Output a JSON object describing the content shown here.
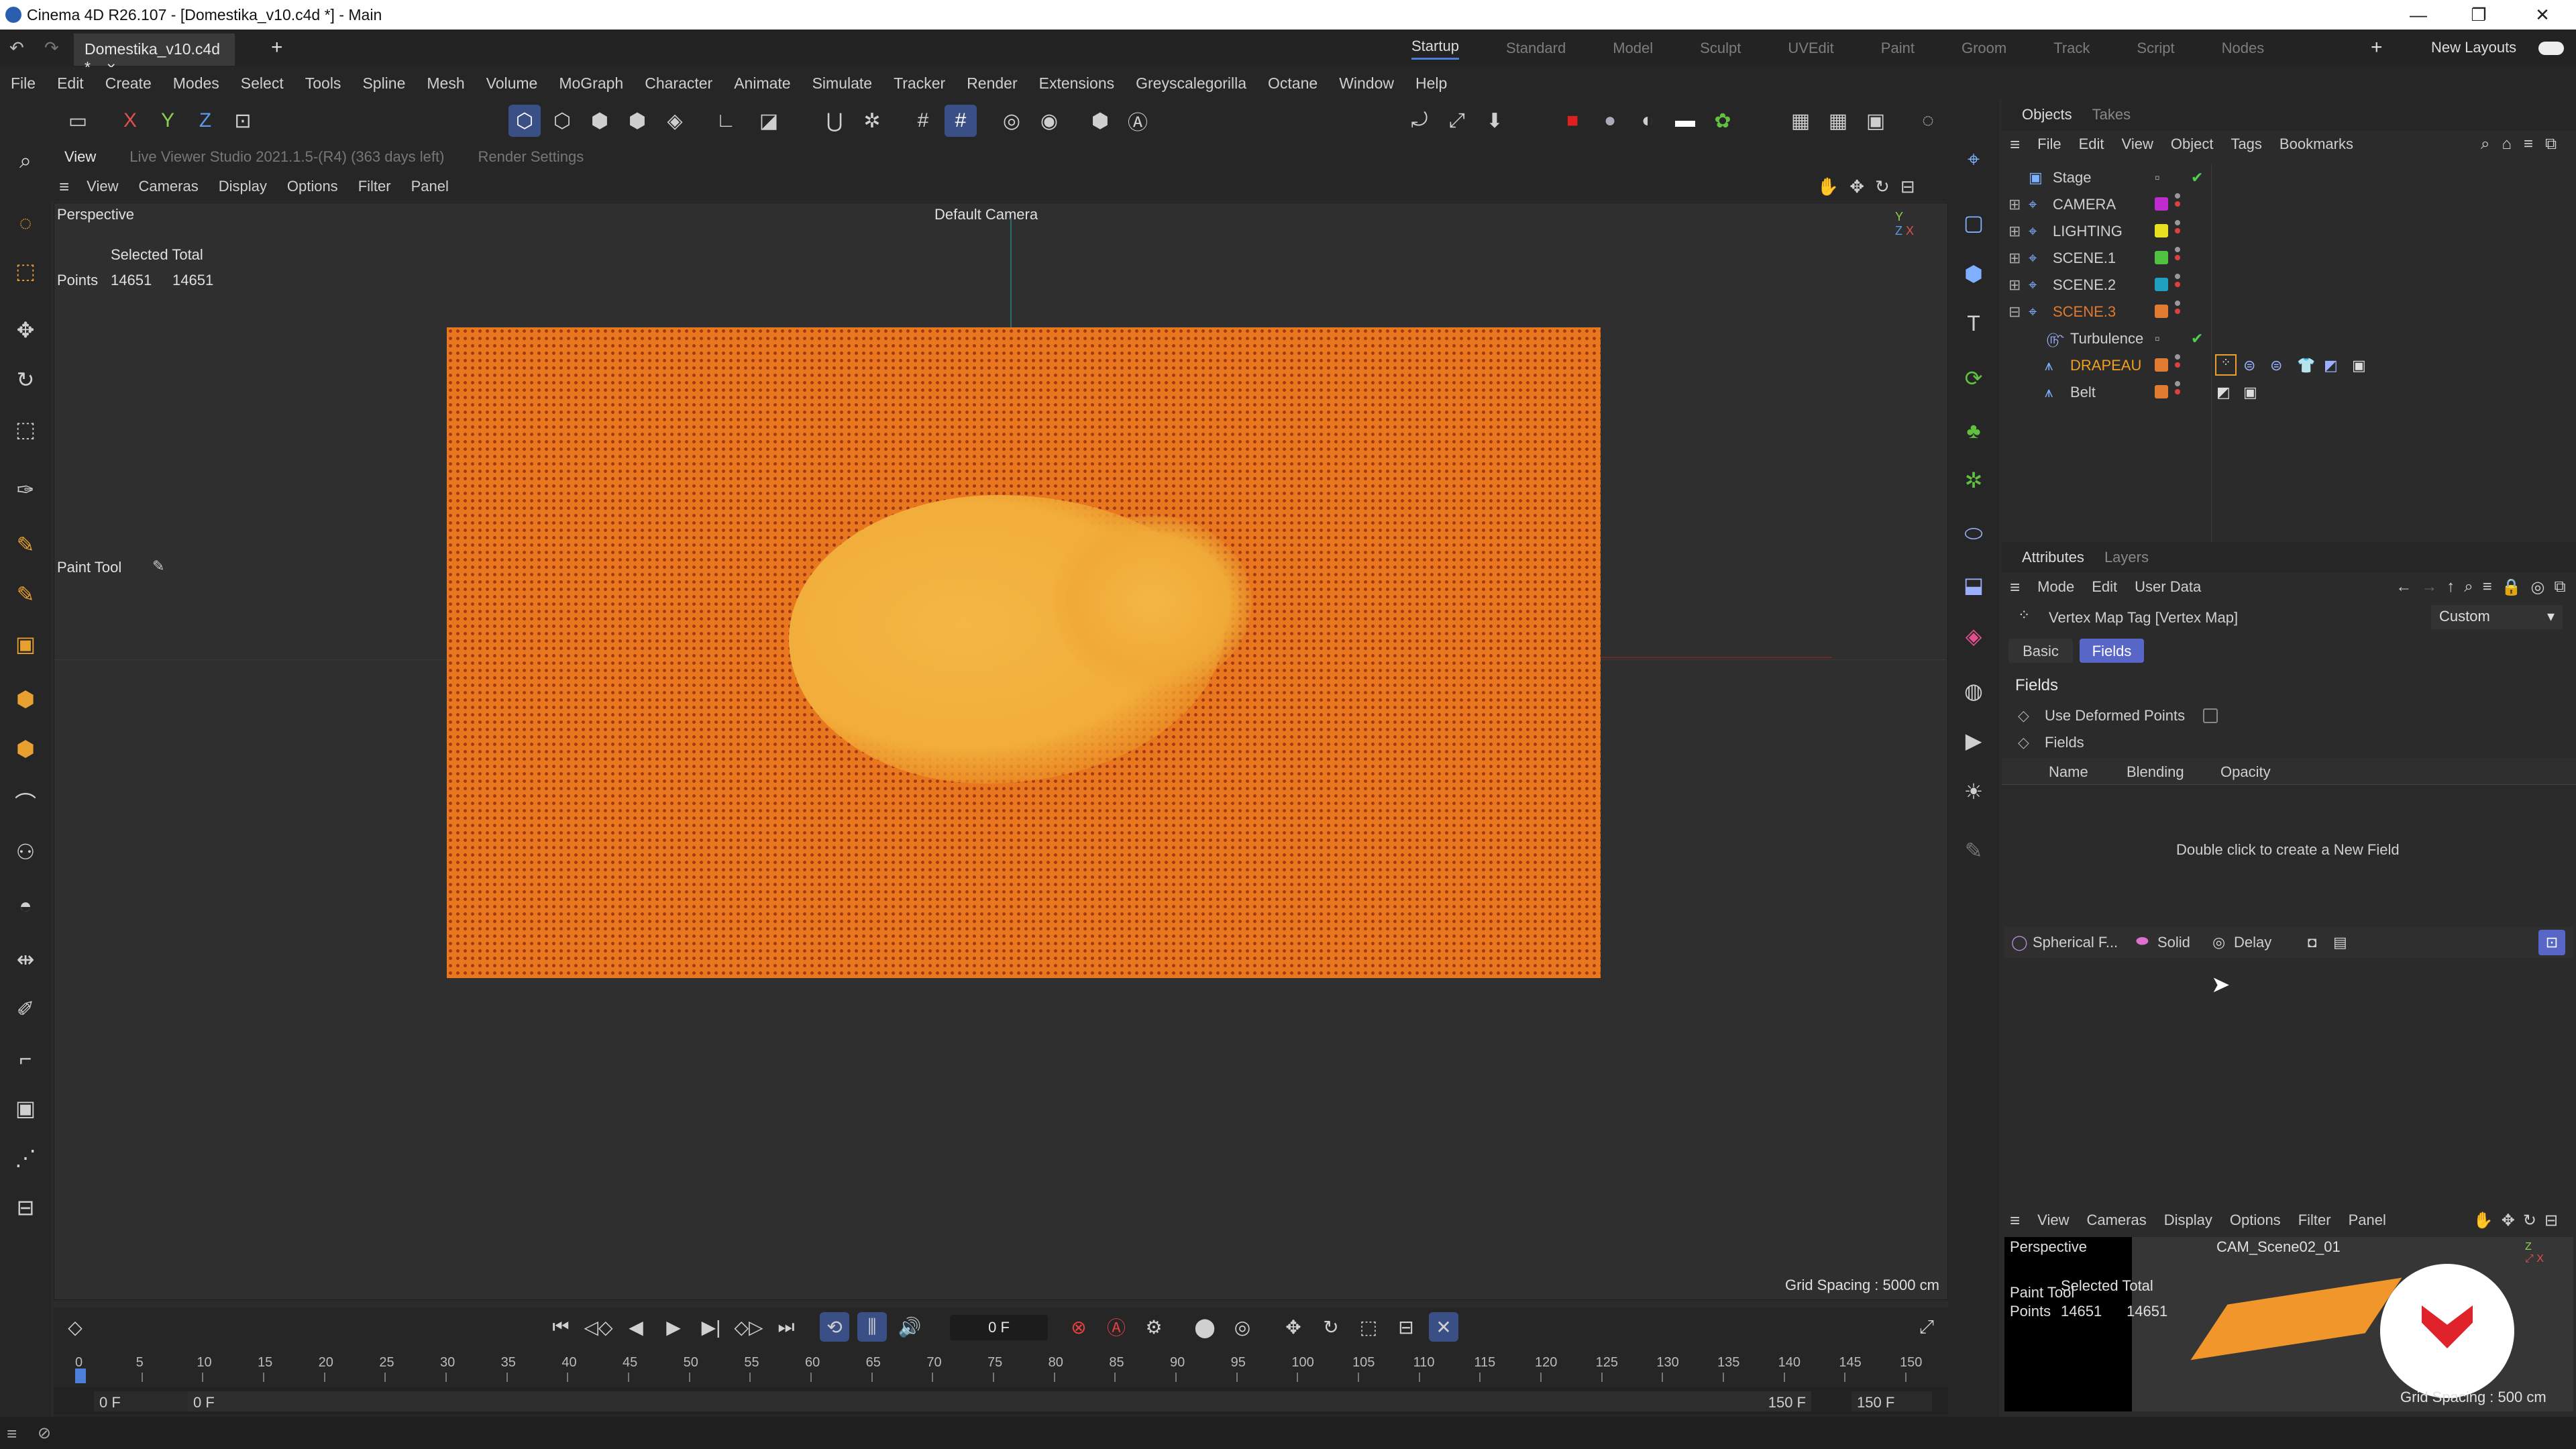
{
  "window": {
    "title": "Cinema 4D R26.107 - [Domestika_v10.c4d *] - Main",
    "min": "—",
    "max": "❐",
    "close": "✕"
  },
  "tabs": {
    "doc": "Domestika_v10.c4d *",
    "close": "×",
    "add": "+"
  },
  "layouts": {
    "items": [
      "Startup",
      "Standard",
      "Model",
      "Sculpt",
      "UVEdit",
      "Paint",
      "Groom",
      "Track",
      "Script",
      "Nodes"
    ],
    "active": "Startup",
    "plus": "+",
    "new_layouts": "New Layouts"
  },
  "menu": [
    "File",
    "Edit",
    "Create",
    "Modes",
    "Select",
    "Tools",
    "Spline",
    "Mesh",
    "Volume",
    "MoGraph",
    "Character",
    "Animate",
    "Simulate",
    "Tracker",
    "Render",
    "Extensions",
    "Greyscalegorilla",
    "Octane",
    "Window",
    "Help"
  ],
  "axis": {
    "x": "X",
    "y": "Y",
    "z": "Z"
  },
  "viewport": {
    "tab_view": "View",
    "tab_live": "Live Viewer Studio 2021.1.5-(R4) (363 days left)",
    "tab_render": "Render Settings",
    "menu": [
      "View",
      "Cameras",
      "Display",
      "Options",
      "Filter",
      "Panel"
    ],
    "perspective": "Perspective",
    "camera": "Default Camera",
    "hud_header": "Selected Total",
    "hud_label": "Points",
    "hud_sel": "14651",
    "hud_total": "14651",
    "paint_tool": "Paint Tool",
    "grid_spacing": "Grid Spacing : 5000 cm"
  },
  "objects": {
    "tabs": [
      "Objects",
      "Takes"
    ],
    "menu": [
      "File",
      "Edit",
      "View",
      "Object",
      "Tags",
      "Bookmarks"
    ],
    "rows": [
      {
        "name": "Stage",
        "color": "#cfcfcf",
        "swatch": ""
      },
      {
        "name": "CAMERA",
        "color": "#cfcfcf",
        "swatch": "#c02bd0"
      },
      {
        "name": "LIGHTING",
        "color": "#cfcfcf",
        "swatch": "#e8e020"
      },
      {
        "name": "SCENE.1",
        "color": "#cfcfcf",
        "swatch": "#50c040"
      },
      {
        "name": "SCENE.2",
        "color": "#cfcfcf",
        "swatch": "#1fa0c0"
      },
      {
        "name": "SCENE.3",
        "color": "#e07a30",
        "swatch": "#e07a30"
      },
      {
        "name": "Turbulence",
        "color": "#cfcfcf",
        "swatch": ""
      },
      {
        "name": "DRAPEAU",
        "color": "#f0a020",
        "swatch": "#e07a30"
      },
      {
        "name": "Belt",
        "color": "#cfcfcf",
        "swatch": "#e07a30"
      }
    ]
  },
  "attributes": {
    "tabs": [
      "Attributes",
      "Layers"
    ],
    "menu": [
      "Mode",
      "Edit",
      "User Data"
    ],
    "tag_title": "Vertex Map Tag [Vertex Map]",
    "preset": "Custom",
    "subtabs": [
      "Basic",
      "Fields"
    ],
    "section": "Fields",
    "use_deformed": "Use Deformed Points",
    "fields_label": "Fields",
    "cols": [
      "Name",
      "Blending",
      "Opacity"
    ],
    "empty": "Double click to create a New Field",
    "field_buttons": [
      "Spherical F...",
      "Solid",
      "Delay"
    ]
  },
  "mini": {
    "menu": [
      "View",
      "Cameras",
      "Display",
      "Options",
      "Filter",
      "Panel"
    ],
    "perspective": "Perspective",
    "camera": "CAM_Scene02_01",
    "paint_tool": "Paint Tool",
    "hud_header": "Selected Total",
    "hud_label": "Points",
    "hud_sel": "14651",
    "hud_total": "14651",
    "grid_spacing": "Grid Spacing : 500 cm"
  },
  "timeline": {
    "frame": "0 F",
    "ticks": [
      "0",
      "5",
      "10",
      "15",
      "20",
      "25",
      "30",
      "35",
      "40",
      "45",
      "50",
      "55",
      "60",
      "65",
      "70",
      "75",
      "80",
      "85",
      "90",
      "95",
      "100",
      "105",
      "110",
      "115",
      "120",
      "125",
      "130",
      "135",
      "140",
      "145",
      "150"
    ],
    "start": "0 F",
    "start2": "0 F",
    "end": "150 F",
    "end2": "150 F"
  }
}
